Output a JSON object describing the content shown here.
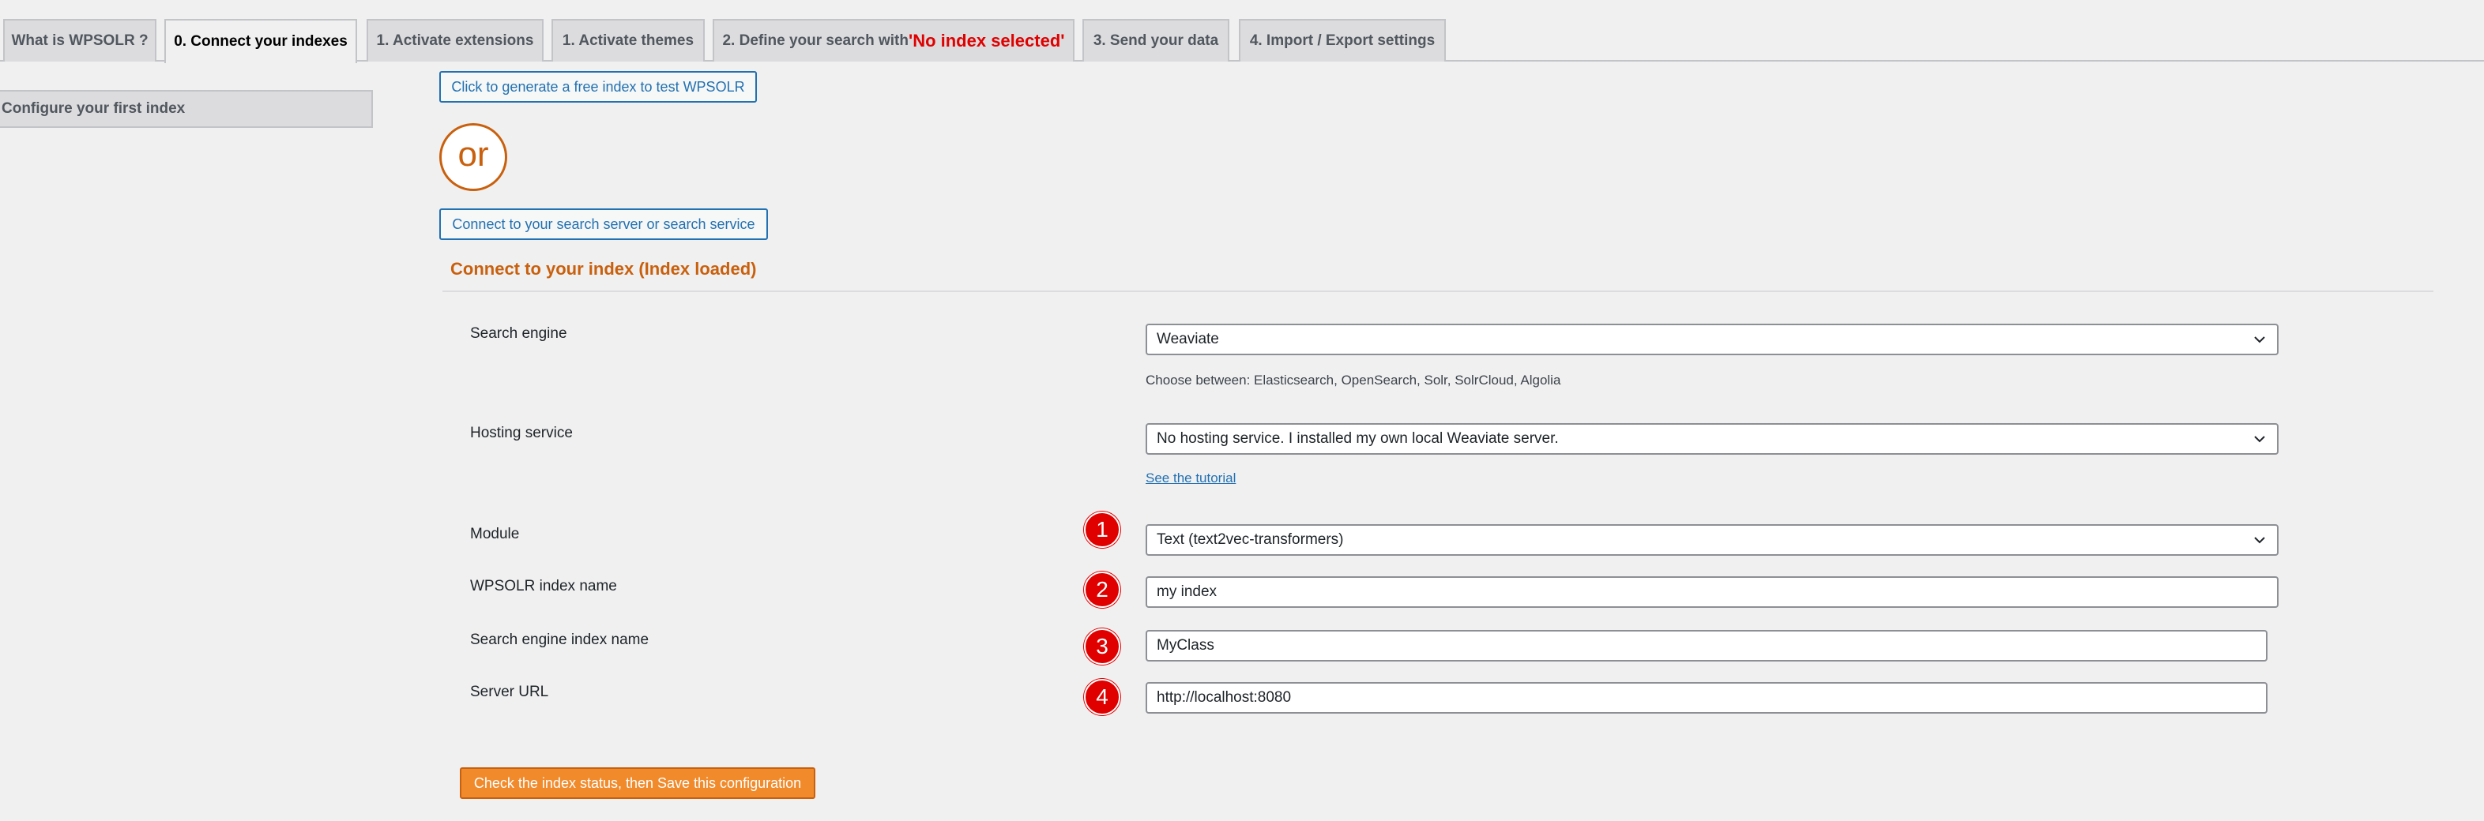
{
  "tabs": [
    {
      "label": "What is WPSOLR ?"
    },
    {
      "label": "0. Connect your indexes"
    },
    {
      "label": "1. Activate extensions"
    },
    {
      "label": "1. Activate themes"
    },
    {
      "label_prefix": "2. Define your search with ",
      "label_quote_open": "'",
      "label_highlight": "No index selected",
      "label_quote_close": "'"
    },
    {
      "label": "3. Send your data"
    },
    {
      "label": "4. Import / Export settings"
    }
  ],
  "sidebar": {
    "items": [
      {
        "label": "Configure your first index"
      }
    ]
  },
  "actions": {
    "generate_free_index": "Click to generate a free index to test WPSOLR",
    "or": "or",
    "connect_server": "Connect to your search server or search service"
  },
  "section": {
    "title": "Connect to your index (Index loaded)"
  },
  "form": {
    "search_engine": {
      "label": "Search engine",
      "value": "Weaviate",
      "help": "Choose between: Elasticsearch, OpenSearch, Solr, SolrCloud, Algolia"
    },
    "hosting_service": {
      "label": "Hosting service",
      "value": "No hosting service. I installed my own local Weaviate server.",
      "link": "See the tutorial"
    },
    "module": {
      "label": "Module",
      "value": "Text (text2vec-transformers)",
      "badge": "1"
    },
    "wpsolr_index_name": {
      "label": "WPSOLR index name",
      "value": "my index",
      "badge": "2"
    },
    "engine_index_name": {
      "label": "Search engine index name",
      "value": "MyClass",
      "badge": "3"
    },
    "server_url": {
      "label": "Server URL",
      "value": "http://localhost:8080",
      "badge": "4"
    }
  },
  "submit": {
    "label": "Check the index status, then Save this configuration"
  },
  "colors": {
    "accent": "#c9600d",
    "link": "#2271b1",
    "badge": "#e00000",
    "save_button": "#f18a2b"
  }
}
